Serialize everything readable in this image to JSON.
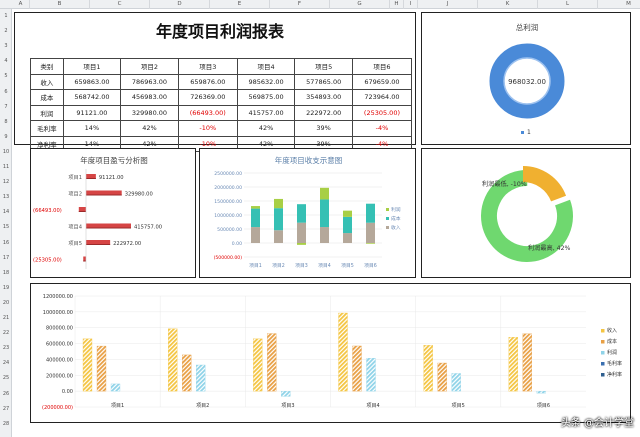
{
  "sheet": {
    "columns": [
      "A",
      "B",
      "C",
      "D",
      "E",
      "F",
      "G",
      "H",
      "I",
      "J",
      "K",
      "L",
      "M"
    ],
    "rows": [
      "1",
      "2",
      "3",
      "4",
      "5",
      "6",
      "7",
      "8",
      "9",
      "10",
      "11",
      "12",
      "13",
      "14",
      "15",
      "16",
      "17",
      "18",
      "19",
      "20",
      "21",
      "22",
      "23",
      "24",
      "25",
      "26",
      "27",
      "28"
    ]
  },
  "report_title": "年度项目利润报表",
  "table": {
    "header": [
      "类别",
      "项目1",
      "项目2",
      "项目3",
      "项目4",
      "项目5",
      "项目6"
    ],
    "rows": [
      [
        "收入",
        "659863.00",
        "786963.00",
        "659876.00",
        "985632.00",
        "577865.00",
        "679659.00"
      ],
      [
        "成本",
        "568742.00",
        "456983.00",
        "726369.00",
        "569875.00",
        "354893.00",
        "723964.00"
      ],
      [
        "利润",
        "91121.00",
        "329980.00",
        "(66493.00)",
        "415757.00",
        "222972.00",
        "(25305.00)"
      ],
      [
        "毛利率",
        "14%",
        "42%",
        "-10%",
        "42%",
        "39%",
        "-4%"
      ],
      [
        "净利率",
        "14%",
        "42%",
        "-10%",
        "42%",
        "39%",
        "-4%"
      ]
    ]
  },
  "colors": {
    "income": "#f4c542",
    "cost": "#e8a045",
    "profit": "#8fd3e8",
    "gross_margin": "#3a6fb0",
    "net_margin": "#2f5f8f",
    "stack_cost": "#b5a89a",
    "stack_income": "#35c0b4",
    "stack_profit": "#a8cf45",
    "neg": "#e00000",
    "bar_red": "#d64545",
    "donut_blue": "#4a8ad8",
    "donut_orange": "#f0b030",
    "donut_green": "#6fd86f"
  },
  "chart_data": [
    {
      "type": "pie",
      "title": "总利润",
      "label": "968032.00",
      "values": [
        968032
      ],
      "legend": [
        "1"
      ]
    },
    {
      "type": "bar",
      "title": "年度项目盈亏分析图",
      "categories": [
        "项目1",
        "项目2",
        "项目3",
        "项目4",
        "项目5",
        "项目6"
      ],
      "values": [
        91121,
        329980,
        -66493,
        415757,
        222972,
        -25305
      ],
      "labels": [
        "91121.00",
        "329980.00",
        "(66493.00)",
        "415757.00",
        "222972.00",
        "(25305.00)"
      ]
    },
    {
      "type": "bar",
      "title": "年度项目收支示意图",
      "categories": [
        "项目1",
        "项目2",
        "项目3",
        "项目4",
        "项目5",
        "项目6"
      ],
      "series": [
        {
          "name": "利润",
          "values": [
            91121,
            329980,
            -66493,
            415757,
            222972,
            -25305
          ]
        },
        {
          "name": "成本",
          "values": [
            568742,
            456983,
            726369,
            569875,
            354893,
            723964
          ]
        },
        {
          "name": "收入",
          "values": [
            659863,
            786963,
            659876,
            985632,
            577865,
            679659
          ]
        }
      ],
      "y_ticks": [
        "2500000.00",
        "2000000.00",
        "1500000.00",
        "1000000.00",
        "500000.00",
        "0.00",
        "(500000.00)"
      ],
      "ylim": [
        -500000,
        2500000
      ]
    },
    {
      "type": "pie",
      "labels": [
        "利润最低, -10%",
        "利润最高, 42%"
      ],
      "values": [
        10,
        42
      ]
    },
    {
      "type": "bar",
      "categories": [
        "项目1",
        "项目2",
        "项目3",
        "项目4",
        "项目5",
        "项目6"
      ],
      "series": [
        {
          "name": "收入",
          "values": [
            659863,
            786963,
            659876,
            985632,
            577865,
            679659
          ]
        },
        {
          "name": "成本",
          "values": [
            568742,
            456983,
            726369,
            569875,
            354893,
            723964
          ]
        },
        {
          "name": "利润",
          "values": [
            91121,
            329980,
            -66493,
            415757,
            222972,
            -25305
          ]
        },
        {
          "name": "毛利率",
          "values": [
            0.14,
            0.42,
            -0.1,
            0.42,
            0.39,
            -0.04
          ]
        },
        {
          "name": "净利率",
          "values": [
            0.14,
            0.42,
            -0.1,
            0.42,
            0.39,
            -0.04
          ]
        }
      ],
      "y_ticks": [
        "1200000.00",
        "1000000.00",
        "800000.00",
        "600000.00",
        "400000.00",
        "200000.00",
        "0.00",
        "(200000.00)"
      ],
      "ylim": [
        -200000,
        1200000
      ]
    }
  ],
  "watermark": "头条 @会计学堂"
}
